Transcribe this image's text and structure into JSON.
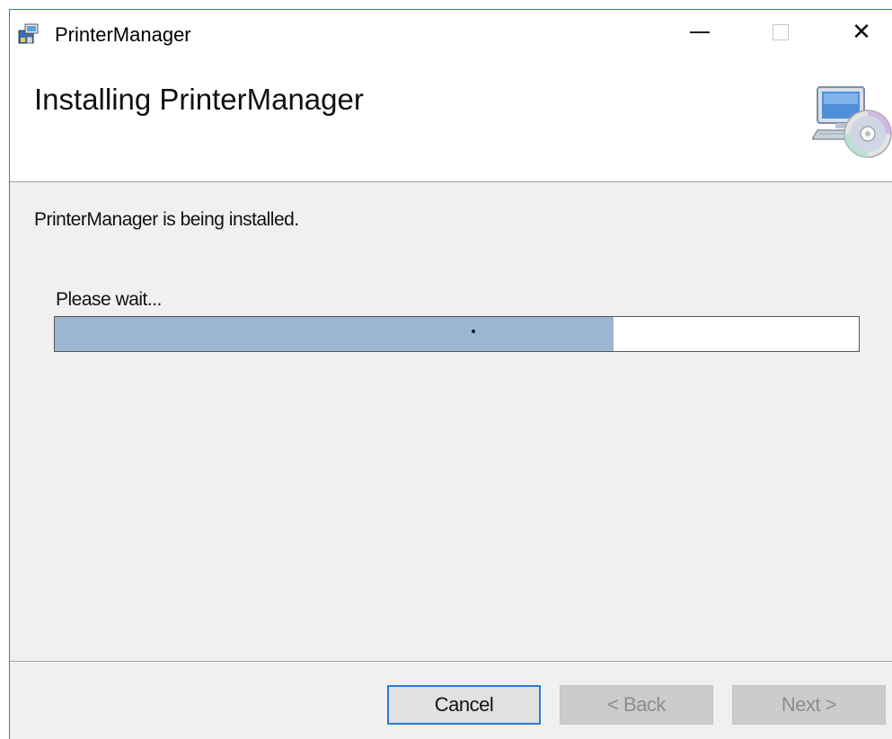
{
  "window": {
    "title": "PrinterManager",
    "icon": "installer-icon",
    "controls": {
      "minimize": "minimize-icon",
      "maximize": "maximize-icon",
      "close": "close-icon",
      "close_glyph": "✕"
    }
  },
  "banner": {
    "title": "Installing PrinterManager",
    "icon": "computer-cd-icon"
  },
  "main": {
    "status_text": "PrinterManager is being installed.",
    "wait_text": "Please wait...",
    "progress_fraction": 0.695
  },
  "buttons": {
    "cancel": "Cancel",
    "back": "< Back",
    "next": "Next >"
  },
  "colors": {
    "progress_fill": "#9bb6d3",
    "focus_border": "#2a7ad6",
    "window_border": "#2b7fd1"
  }
}
